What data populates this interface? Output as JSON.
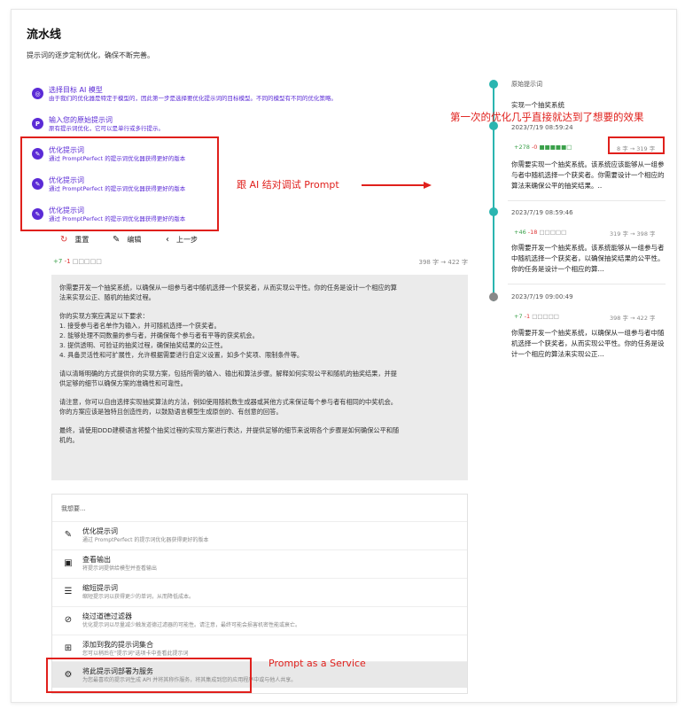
{
  "page": {
    "title": "流水线",
    "subtitle": "提示词的逐步定制优化，确保不断完善。"
  },
  "steps": [
    {
      "icon": "target-icon",
      "glyph": "◎",
      "title": "选择目标 AI 模型",
      "desc": "由于我们的优化器是特定于模型的，因此第一步是选择要优化提示词的目标模型。不同的模型有不同的优化策略。"
    },
    {
      "icon": "p-letter-icon",
      "glyph": "P",
      "title": "输入您的原始提示词",
      "desc": "原有提示词优化，它可以是单行或多行提示。"
    },
    {
      "icon": "pencil-icon",
      "glyph": "✎",
      "title": "优化提示词",
      "desc": "通过 PromptPerfect 的提示词优化器获得更好的版本"
    },
    {
      "icon": "pencil-icon",
      "glyph": "✎",
      "title": "优化提示词",
      "desc": "通过 PromptPerfect 的提示词优化器获得更好的版本"
    },
    {
      "icon": "pencil-icon",
      "glyph": "✎",
      "title": "优化提示词",
      "desc": "通过 PromptPerfect 的提示词优化器获得更好的版本"
    }
  ],
  "controls": {
    "reset": "重置",
    "edit": "编辑",
    "prev": "上一步"
  },
  "diff": {
    "added": "+7",
    "removed": "-1",
    "boxes": "□□□□□",
    "counts": "398 字 → 422 字"
  },
  "prompt_paragraphs": [
    [
      "你需要开发一个抽奖系统，以确保从一组参与者中随机选择一个获奖者，从而实现公平性。你的任务是设计一个相应的算",
      "法来实现公正、随机的抽奖过程。"
    ],
    [
      "你的实现方案应满足以下要求：",
      "1. 接受参与者名单作为输入，并可随机选择一个获奖者。",
      "2. 能够处理不同数量的参与者，并确保每个参与者有平等的获奖机会。",
      "3. 提供透明、可验证的抽奖过程，确保抽奖结果的公正性。",
      "4. 具备灵活性和可扩展性，允许根据需要进行自定义设置，如多个奖项、限制条件等。"
    ],
    [
      "请以清晰明确的方式提供你的实现方案，包括所需的输入、输出和算法步骤。解释如何实现公平和随机的抽奖结果，并提",
      "供足够的细节以确保方案的准确性和可靠性。"
    ],
    [
      "请注意，你可以自由选择实现抽奖算法的方法，例如使用随机数生成器或其他方式来保证每个参与者有相同的中奖机会。",
      "你的方案应该是独特且创造性的，以鼓励语言模型生成原创的、有创意的回答。"
    ],
    [
      "最终，请使用DDD建模语言将整个抽奖过程的实现方案进行表达，并提供足够的细节来说明各个步骤是如何确保公平和随",
      "机的。"
    ]
  ],
  "menu": {
    "header": "我想要...",
    "items": [
      {
        "icon": "magic-wand-icon",
        "glyph": "✎",
        "label": "优化提示词",
        "desc": "通过 PromptPerfect 的提示词优化器获得更好的版本"
      },
      {
        "icon": "output-icon",
        "glyph": "▣",
        "label": "查看输出",
        "desc": "将提示词提供给模型并查看输出"
      },
      {
        "icon": "shorten-icon",
        "glyph": "☰",
        "label": "缩短提示词",
        "desc": "缩短提示词以获得更少的单词，从而降低成本。"
      },
      {
        "icon": "bypass-filter-icon",
        "glyph": "⊘",
        "label": "绕过道德过滤器",
        "desc": "优化提示词以尽量减少触发道德过滤器的可能性。请注意，最终可能会损害机密性能或衰亡。"
      },
      {
        "icon": "collection-icon",
        "glyph": "⊞",
        "label": "添加到我的提示词集合",
        "desc": "您可以稍后在\"提示词\"选项卡中查看此提示词"
      },
      {
        "icon": "deploy-service-icon",
        "glyph": "⚙",
        "label": "将此提示词部署为服务",
        "desc": "为您最喜欢的提示词生成 API 并将其称作服务，将其集成到您的应用程序中或与他人共享。"
      }
    ]
  },
  "timeline": {
    "original": {
      "label": "原始提示词",
      "text": "实现一个抽奖系统"
    },
    "versions": [
      {
        "date": "2023/7/19 08:59:24",
        "added": "+278",
        "removed": "-0",
        "bar": "■■■■■□",
        "counts": "8 字 → 319 字",
        "text": "你需要实现一个抽奖系统。该系统应该能够从一组参与者中随机选择一个获奖者。你需要设计一个相应的算法来确保公平的抽奖结果。.."
      },
      {
        "date": "2023/7/19 08:59:46",
        "added": "+46",
        "removed": "-18",
        "bar": "□□□□□",
        "counts": "319 字 → 398 字",
        "text": "你需要开发一个抽奖系统。该系统能够从一组参与者中随机选择一个获奖者，以确保抽奖结果的公平性。你的任务是设计一个相应的算..."
      },
      {
        "date": "2023/7/19 09:00:49",
        "added": "+7",
        "removed": "-1",
        "bar": "□□□□□",
        "counts": "398 字 → 422 字",
        "text": "你需要开发一个抽奖系统，以确保从一组参与者中随机选择一个获奖者，从而实现公平性。你的任务是设计一个相应的算法来实现公正..."
      }
    ]
  },
  "annotations": {
    "top_right": "第一次的优化几乎直接就达到了想要的效果",
    "middle": "跟 AI 结对调试 Prompt",
    "bottom": "Prompt as a Service"
  },
  "colors": {
    "accent": "#5b2bd6",
    "timeline": "#2ab5b0",
    "annotation": "#e0201c",
    "added": "#3aa04a",
    "removed": "#dd3333"
  }
}
